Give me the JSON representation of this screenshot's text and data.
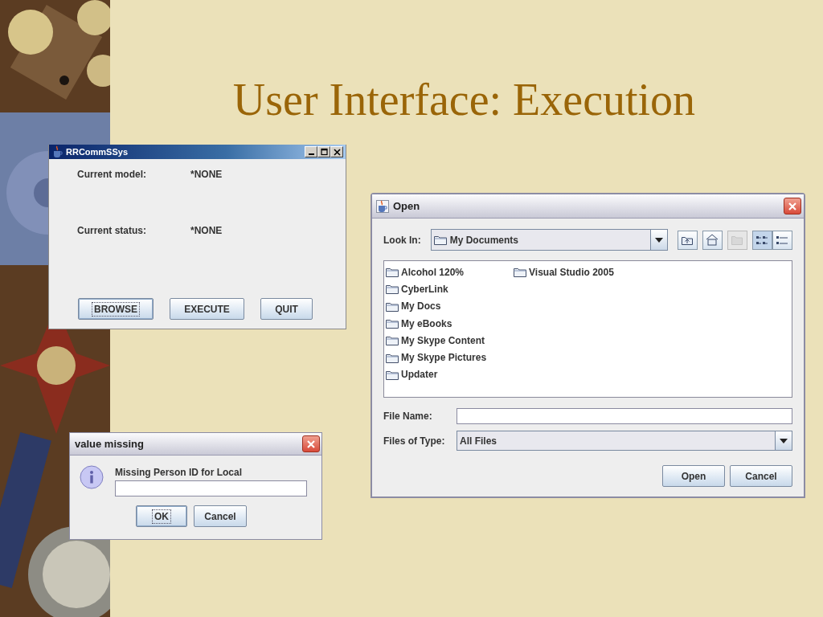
{
  "slide": {
    "title": "User Interface: Execution"
  },
  "main_window": {
    "title": "RRCommSSys",
    "fields": [
      {
        "label": "Current model:",
        "value": "*NONE"
      },
      {
        "label": "Current status:",
        "value": "*NONE"
      }
    ],
    "buttons": [
      {
        "label": "BROWSE",
        "focused": true
      },
      {
        "label": "EXECUTE",
        "focused": false
      },
      {
        "label": "QUIT",
        "focused": false
      }
    ]
  },
  "open_dialog": {
    "title": "Open",
    "look_in": {
      "label": "Look In:",
      "value": "My Documents"
    },
    "nav_buttons": [
      {
        "kind": "up",
        "disabled": false
      },
      {
        "kind": "home",
        "disabled": false
      },
      {
        "kind": "new-folder",
        "disabled": true
      }
    ],
    "view_buttons": [
      {
        "kind": "list",
        "selected": true
      },
      {
        "kind": "details",
        "selected": false
      }
    ],
    "files": [
      "Alcohol 120%",
      "CyberLink",
      "My Docs",
      "My eBooks",
      "My Skype Content",
      "My Skype Pictures",
      "Updater",
      "Visual Studio 2005"
    ],
    "file_name": {
      "label": "File Name:"
    },
    "file_type": {
      "label": "Files of Type:",
      "value": "All Files"
    },
    "buttons": [
      {
        "label": "Open"
      },
      {
        "label": "Cancel"
      }
    ]
  },
  "input_dialog": {
    "title": "value missing",
    "message": "Missing Person ID for Local",
    "buttons": [
      {
        "label": "OK",
        "focused": true
      },
      {
        "label": "Cancel",
        "focused": false
      }
    ]
  }
}
